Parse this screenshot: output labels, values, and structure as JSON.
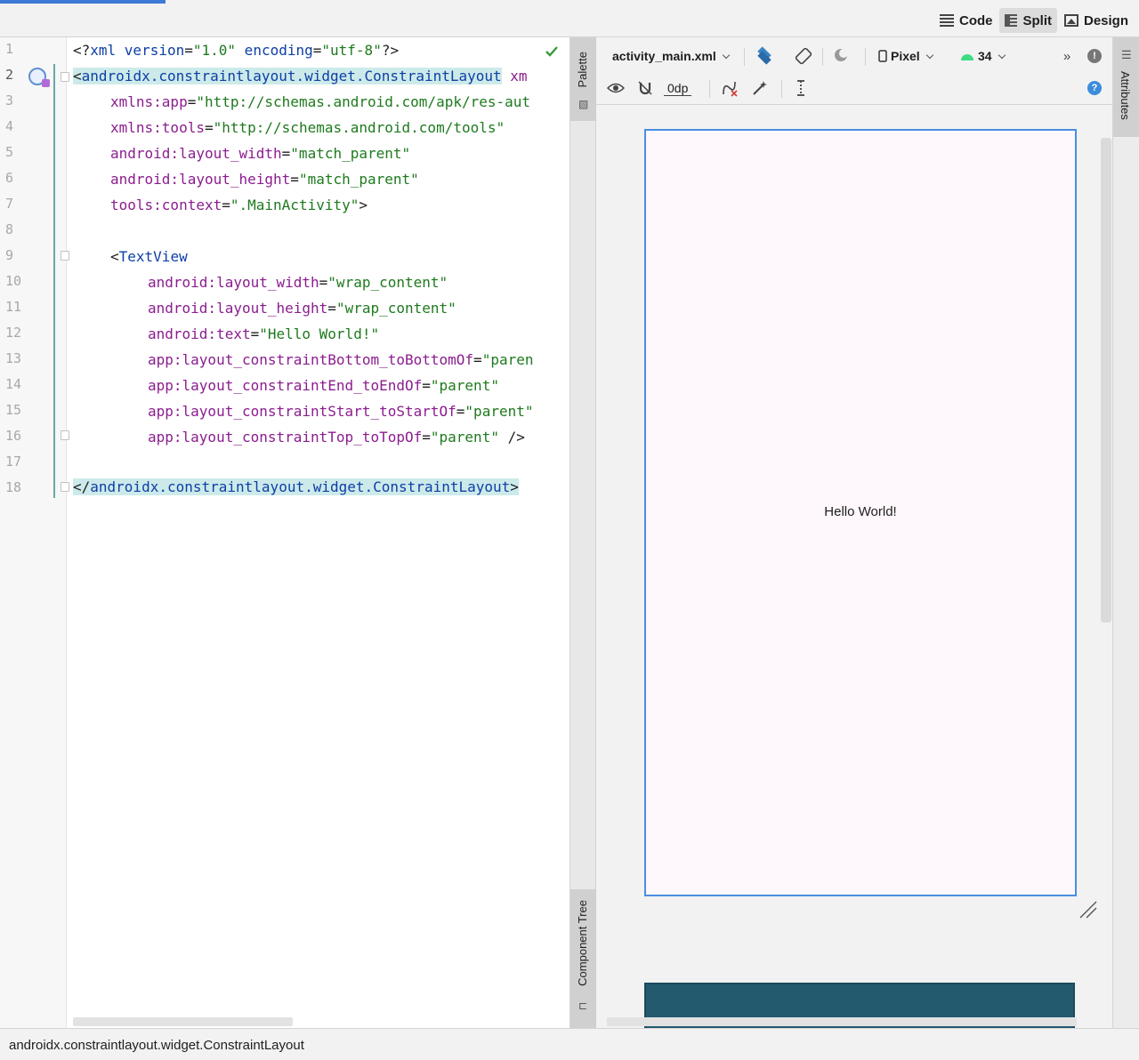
{
  "toolbar": {
    "modes": [
      {
        "label": "Code",
        "icon": "list-lines-icon",
        "active": false
      },
      {
        "label": "Split",
        "icon": "split-view-icon",
        "active": true
      },
      {
        "label": "Design",
        "icon": "image-icon",
        "active": false
      }
    ]
  },
  "editor": {
    "line_numbers": [
      "1",
      "2",
      "3",
      "4",
      "5",
      "6",
      "7",
      "8",
      "9",
      "10",
      "11",
      "12",
      "13",
      "14",
      "15",
      "16",
      "17",
      "18"
    ],
    "current_line": "2",
    "lines": {
      "l1": {
        "a": "<?",
        "b": "xml version",
        "c": "=",
        "d": "\"1.0\"",
        "e": " encoding",
        "f": "=",
        "g": "\"utf-8\"",
        "h": "?>"
      },
      "l2": {
        "a": "<",
        "b": "androidx.constraintlayout.widget.ConstraintLayout",
        "c": " xm"
      },
      "l3": {
        "a": "xmlns:app",
        "b": "=",
        "c": "\"http://schemas.android.com/apk/res-aut"
      },
      "l4": {
        "a": "xmlns:tools",
        "b": "=",
        "c": "\"http://schemas.android.com/tools\""
      },
      "l5": {
        "a": "android:layout_width",
        "b": "=",
        "c": "\"match_parent\""
      },
      "l6": {
        "a": "android:layout_height",
        "b": "=",
        "c": "\"match_parent\""
      },
      "l7": {
        "a": "tools:context",
        "b": "=",
        "c": "\".MainActivity\"",
        "d": ">"
      },
      "l9": {
        "a": "<",
        "b": "TextView"
      },
      "l10": {
        "a": "android:layout_width",
        "b": "=",
        "c": "\"wrap_content\""
      },
      "l11": {
        "a": "android:layout_height",
        "b": "=",
        "c": "\"wrap_content\""
      },
      "l12": {
        "a": "android:text",
        "b": "=",
        "c": "\"Hello World!\""
      },
      "l13": {
        "a": "app:layout_constraintBottom_toBottomOf",
        "b": "=",
        "c": "\"paren"
      },
      "l14": {
        "a": "app:layout_constraintEnd_toEndOf",
        "b": "=",
        "c": "\"parent\""
      },
      "l15": {
        "a": "app:layout_constraintStart_toStartOf",
        "b": "=",
        "c": "\"parent\""
      },
      "l16": {
        "a": "app:layout_constraintTop_toTopOf",
        "b": "=",
        "c": "\"parent\"",
        "d": " />"
      },
      "l18": {
        "a": "</",
        "b": "androidx.constraintlayout.widget.ConstraintLayout",
        "c": ">"
      }
    }
  },
  "side_tabs": {
    "palette": "Palette",
    "component_tree": "Component Tree",
    "attributes": "Attributes"
  },
  "design": {
    "file_selector": "activity_main.xml",
    "device": "Pixel",
    "api_level": "34",
    "margin_value": "0dp",
    "icons": [
      "layers-icon",
      "rotate-icon",
      "night-mode-icon",
      "phone-icon",
      "android-icon",
      "more-icon",
      "info-icon",
      "eye-icon",
      "magnet-off-icon",
      "clear-constraints-icon",
      "magic-wand-icon",
      "guidelines-icon",
      "help-icon"
    ],
    "preview_text": "Hello World!",
    "device_background": "#fef7fb",
    "blueprint_color": "#245a6e",
    "selection_color": "#4a8ee0"
  },
  "status": {
    "breadcrumb": "androidx.constraintlayout.widget.ConstraintLayout"
  }
}
